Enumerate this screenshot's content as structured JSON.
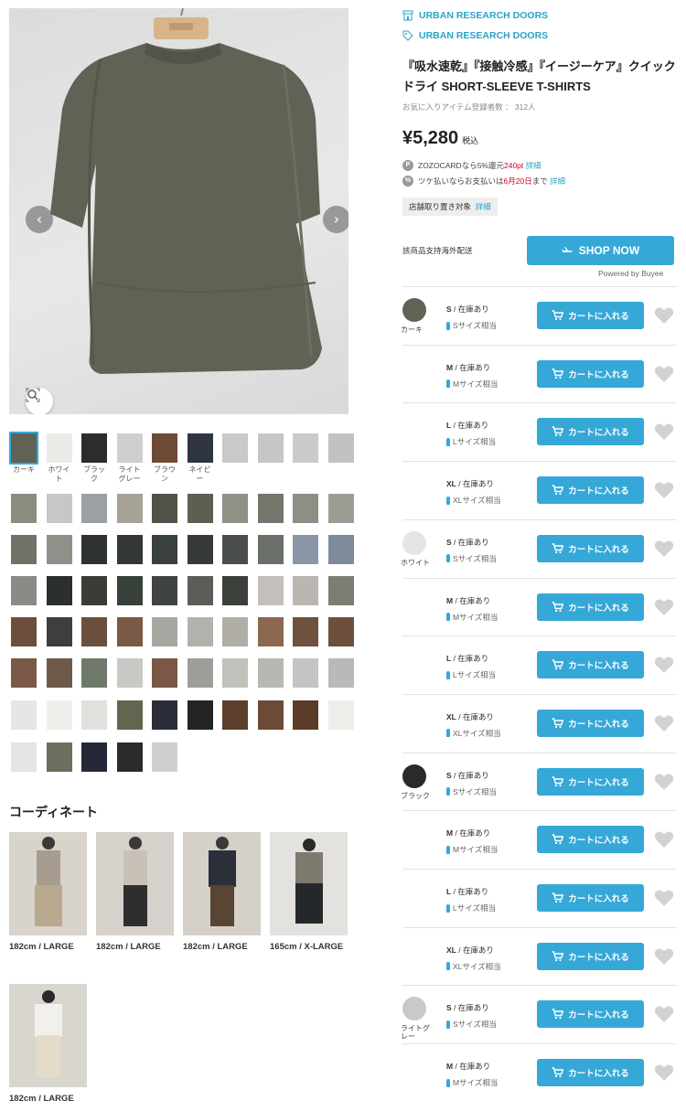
{
  "brand_lines": [
    "URBAN RESEARCH DOORS",
    "URBAN RESEARCH DOORS"
  ],
  "product": {
    "title": "『吸水速乾』『接触冷感』『イージーケア』クイックドライ SHORT-SLEEVE T-SHIRTS",
    "favorite_count_label": "お気に入りアイテム登録者数 ： 312人",
    "price": "¥5,280",
    "tax_label": "税込",
    "zozocard_prefix": "ZOZOCARDなら5%還元",
    "zozocard_points": "240pt",
    "zozocard_detail": "詳細",
    "tsuke_prefix": "ツケ払いならお支払いは",
    "tsuke_date": "6月20日",
    "tsuke_suffix": "まで",
    "tsuke_detail": "詳細",
    "store_pickup": "店舗取り置き対象",
    "store_pickup_detail": "詳細"
  },
  "overseas": {
    "label": "該商品支持海外配送",
    "button": "SHOP NOW",
    "powered": "Powered by Buyee"
  },
  "thumbnail_labels": [
    "カーキ",
    "ホワイト",
    "ブラック",
    "ライトグレー",
    "ブラウン",
    "ネイビー"
  ],
  "colors": [
    {
      "name": "カーキ",
      "swatch": "#5f6254"
    },
    {
      "name": "ホワイト",
      "swatch": "#e6e5e2"
    },
    {
      "name": "ブラック",
      "swatch": "#2a2a2a"
    },
    {
      "name": "ライトグレー",
      "swatch": "#c9c9c7"
    }
  ],
  "rows": [
    {
      "size": "S",
      "stock": "在庫あり",
      "fit": "Sサイズ相当"
    },
    {
      "size": "M",
      "stock": "在庫あり",
      "fit": "Mサイズ相当"
    },
    {
      "size": "L",
      "stock": "在庫あり",
      "fit": "Lサイズ相当"
    },
    {
      "size": "XL",
      "stock": "在庫あり",
      "fit": "XLサイズ相当"
    }
  ],
  "cart_label": "カートに入れる",
  "coordinate": {
    "title": "コーディネート",
    "items": [
      {
        "caption": "182cm / LARGE"
      },
      {
        "caption": "182cm / LARGE"
      },
      {
        "caption": "182cm / LARGE"
      },
      {
        "caption": "165cm / X-LARGE"
      },
      {
        "caption": "182cm / LARGE"
      }
    ]
  },
  "accent_color": "#35a8d8"
}
